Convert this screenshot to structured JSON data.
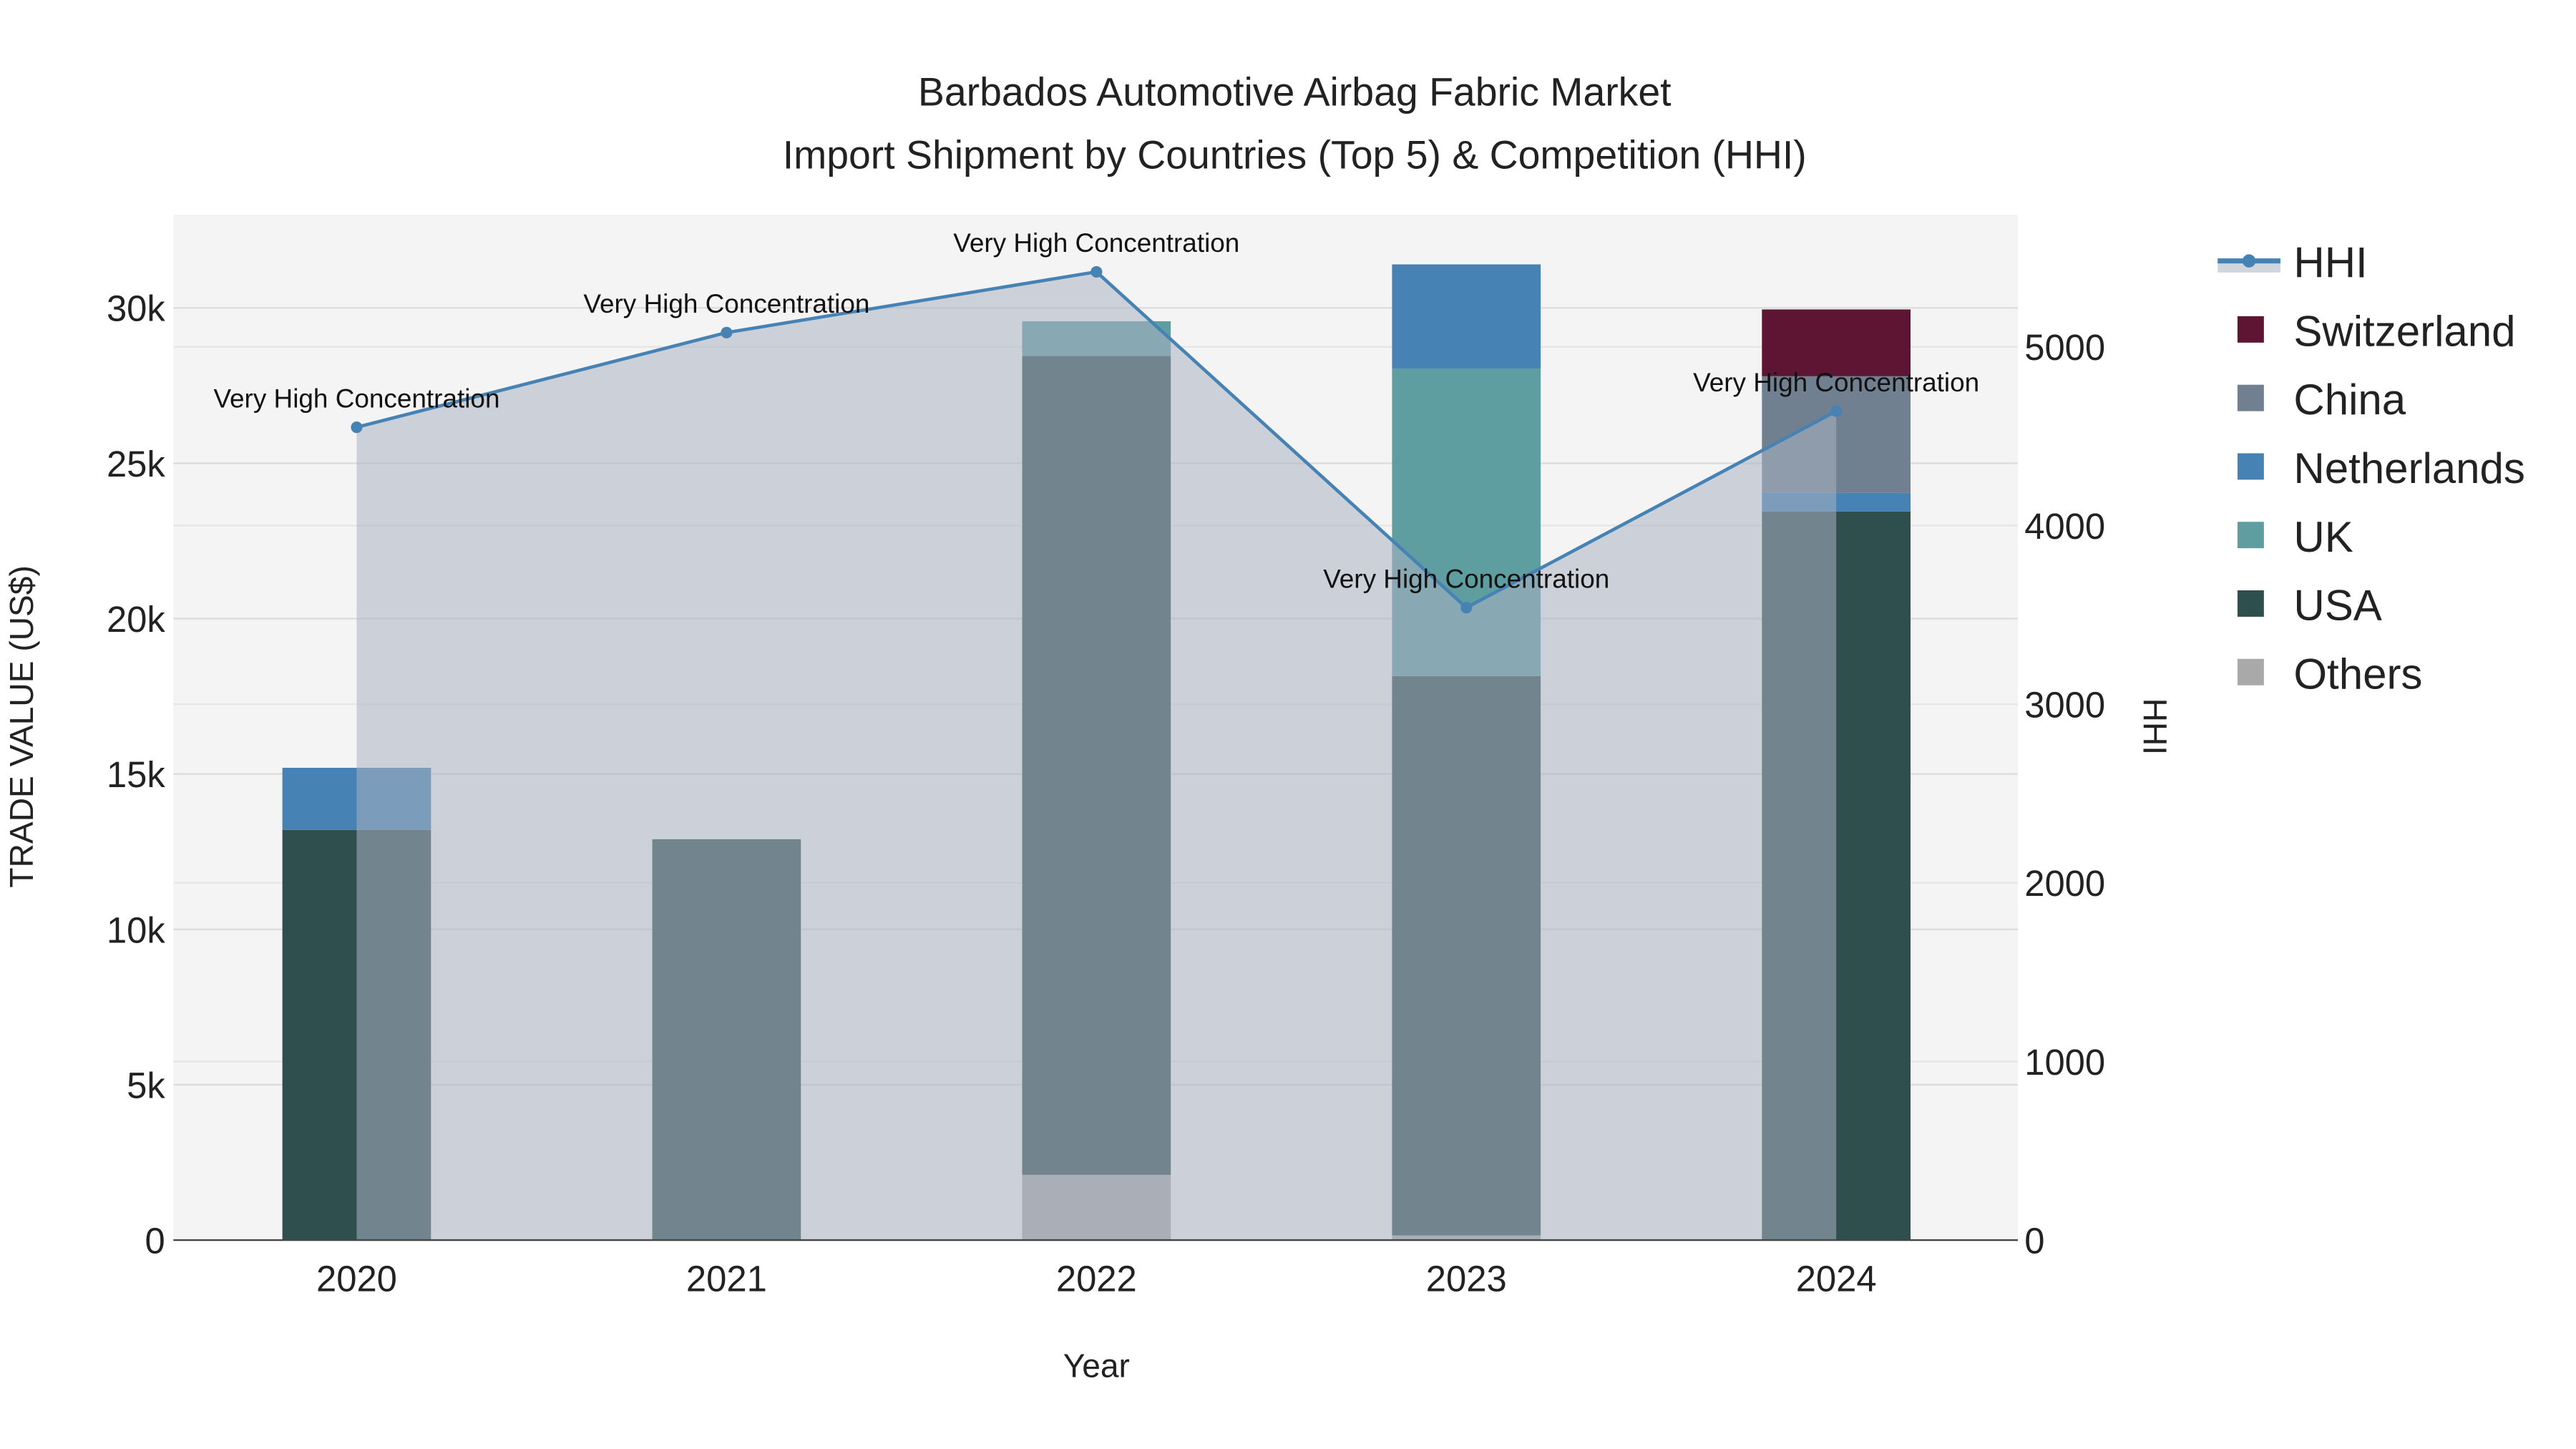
{
  "chart_data": {
    "type": "bar",
    "stacked": true,
    "title": "Barbados Automotive Airbag Fabric Market",
    "subtitle": "Import Shipment by Countries (Top 5) & Competition (HHI)",
    "xlabel": "Year",
    "ylabel": "TRADE VALUE (US$)",
    "y2label": "HHI",
    "categories": [
      "2020",
      "2021",
      "2022",
      "2023",
      "2024"
    ],
    "ylim": [
      0,
      33000
    ],
    "y_ticks": [
      0,
      5000,
      10000,
      15000,
      20000,
      25000,
      30000
    ],
    "y_tick_labels": [
      "0",
      "5k",
      "10k",
      "15k",
      "20k",
      "25k",
      "30k"
    ],
    "y2lim": [
      0,
      5740
    ],
    "y2_ticks": [
      0,
      1000,
      2000,
      3000,
      4000,
      5000
    ],
    "y2_tick_labels": [
      "0",
      "1000",
      "2000",
      "3000",
      "4000",
      "5000"
    ],
    "grid": true,
    "legend_placement": "right",
    "series": [
      {
        "name": "Others",
        "color": "#a9a9a9",
        "values": [
          0,
          0,
          2100,
          150,
          0
        ]
      },
      {
        "name": "USA",
        "color": "#2f4f4f",
        "values": [
          13200,
          12900,
          26350,
          18000,
          23450
        ]
      },
      {
        "name": "UK",
        "color": "#5f9ea0",
        "values": [
          0,
          0,
          1120,
          9900,
          0
        ]
      },
      {
        "name": "Netherlands",
        "color": "#4682b4",
        "values": [
          2000,
          0,
          0,
          3350,
          600
        ]
      },
      {
        "name": "China",
        "color": "#708090",
        "values": [
          0,
          0,
          0,
          0,
          3750
        ]
      },
      {
        "name": "Switzerland",
        "color": "#5e1433",
        "values": [
          0,
          0,
          0,
          0,
          2150
        ]
      }
    ],
    "hhi": {
      "name": "HHI",
      "color": "#4682b4",
      "values": [
        4550,
        5080,
        5420,
        3540,
        4640
      ],
      "annotations": [
        "Very High Concentration",
        "Very High Concentration",
        "Very High Concentration",
        "Very High Concentration",
        "Very High Concentration"
      ]
    },
    "legend_order": [
      "HHI",
      "Switzerland",
      "China",
      "Netherlands",
      "UK",
      "USA",
      "Others"
    ]
  }
}
